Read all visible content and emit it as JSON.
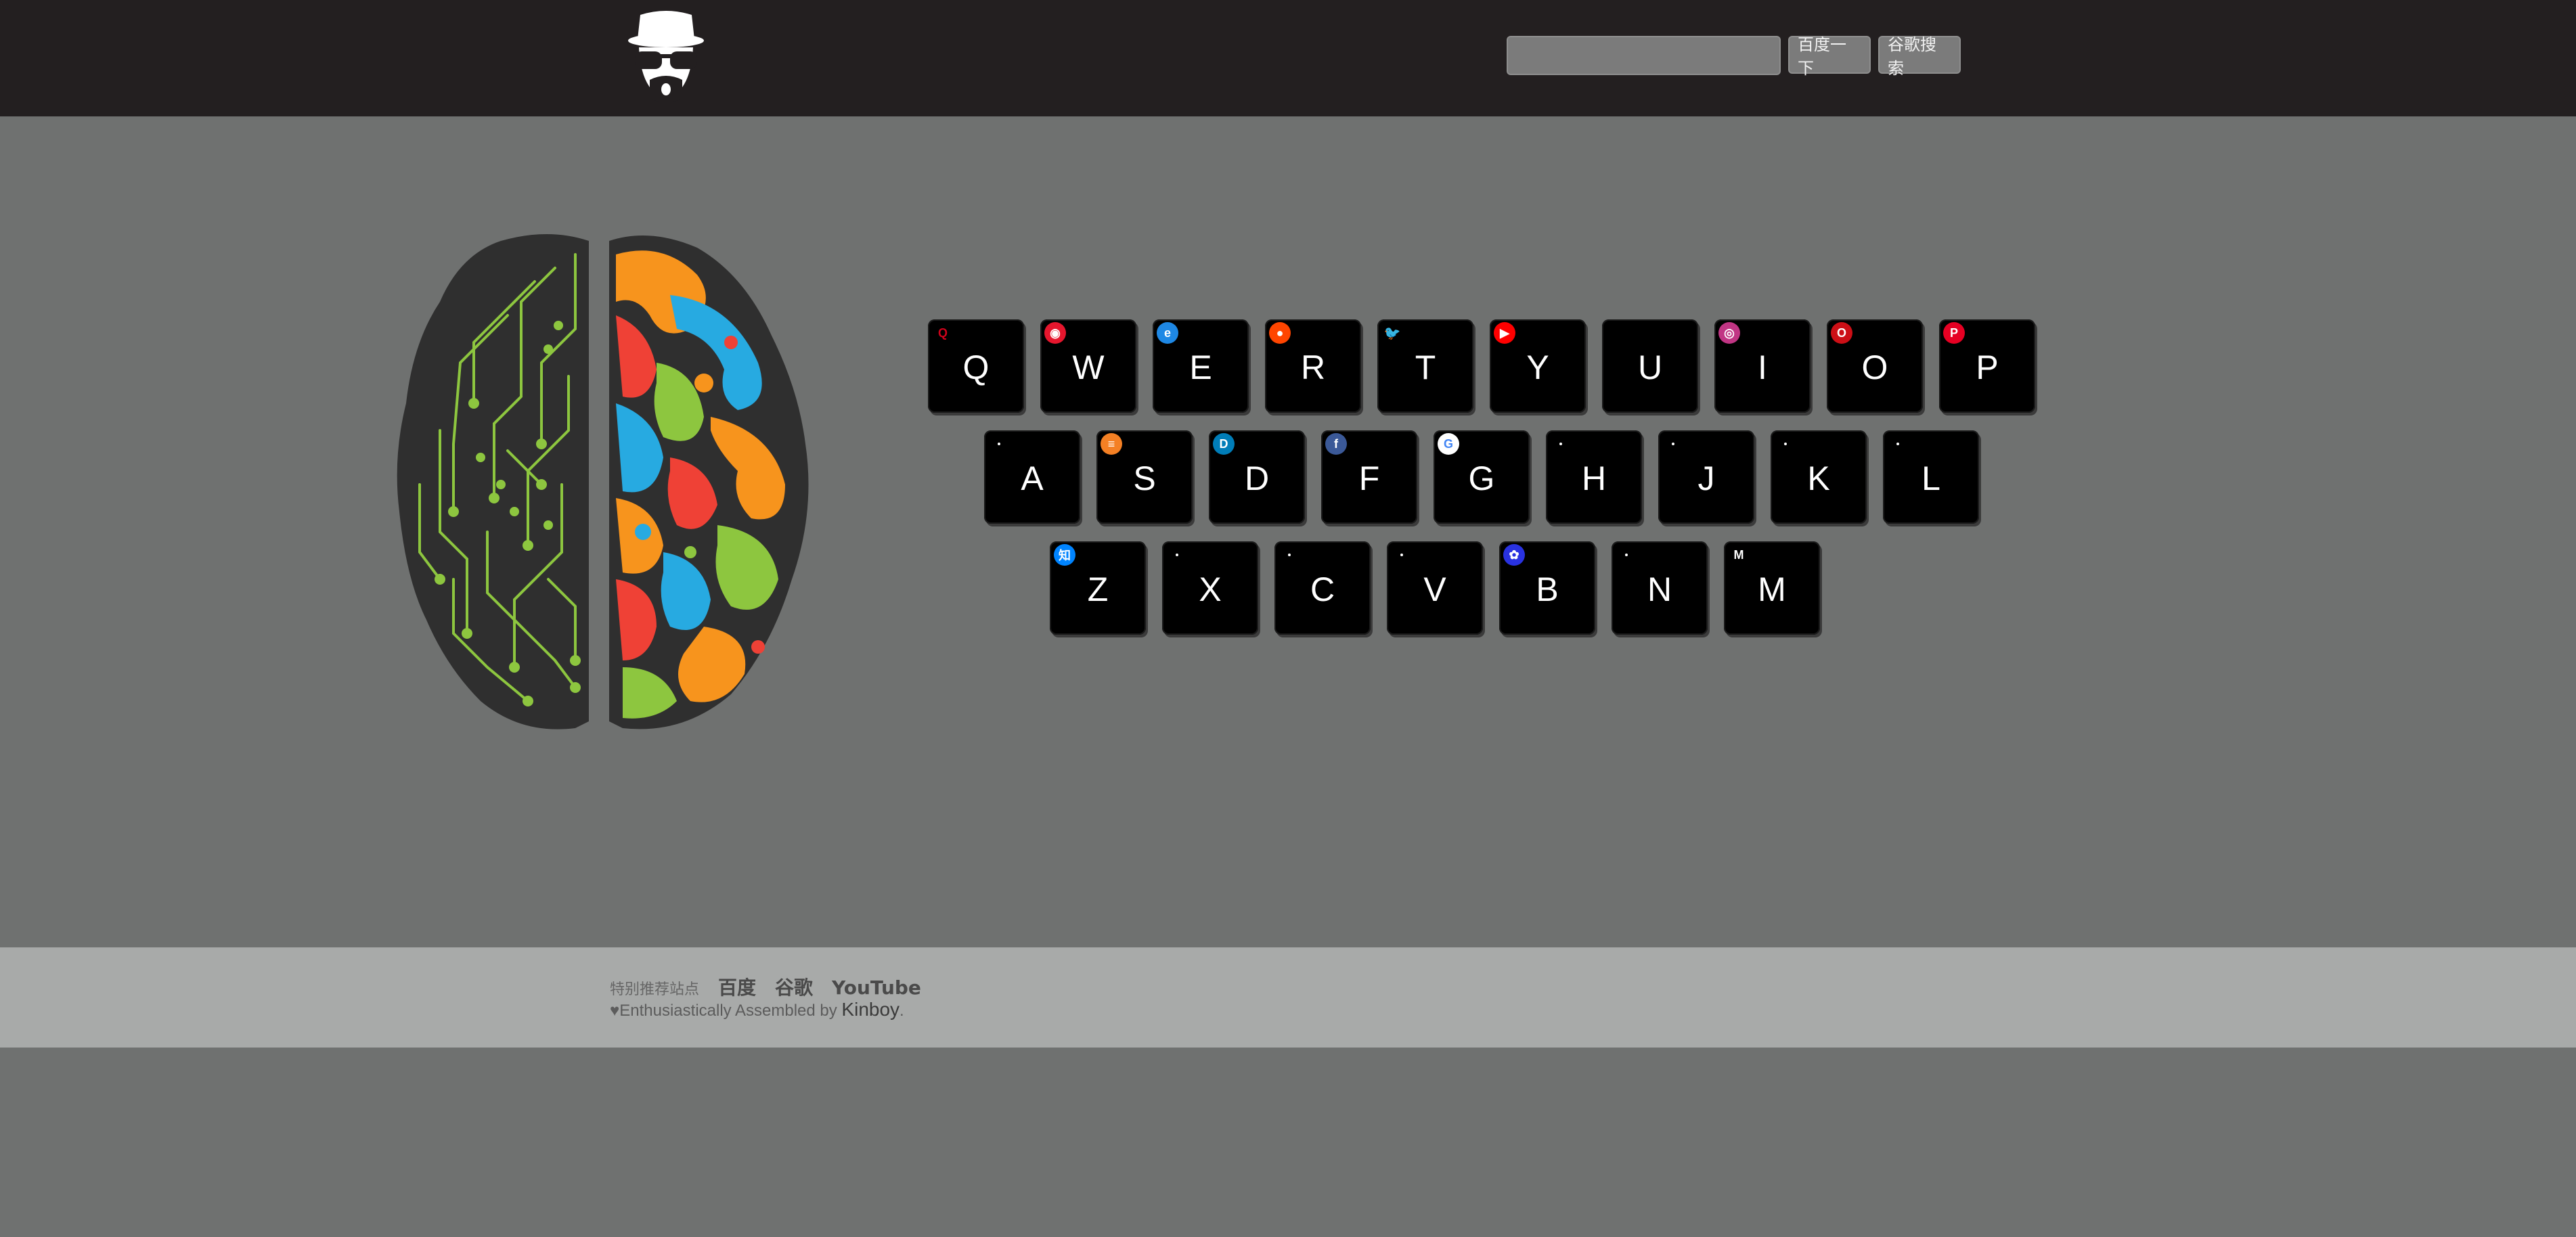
{
  "header": {
    "search_placeholder": "",
    "baidu_button": "百度一下",
    "google_button": "谷歌搜索"
  },
  "keyboard": {
    "row1": [
      {
        "letter": "Q",
        "icon": "qq-icon",
        "color": "#d0021b",
        "glyph": "Q"
      },
      {
        "letter": "W",
        "icon": "weibo-icon",
        "color": "#e6162d",
        "glyph": "◉"
      },
      {
        "letter": "E",
        "icon": "e-icon",
        "color": "#1e88e5",
        "glyph": "e"
      },
      {
        "letter": "R",
        "icon": "reddit-icon",
        "color": "#ff4500",
        "glyph": "●"
      },
      {
        "letter": "T",
        "icon": "twitter-icon",
        "color": "#000000",
        "glyph": "🐦"
      },
      {
        "letter": "Y",
        "icon": "youtube-icon",
        "color": "#ff0000",
        "glyph": "▶"
      },
      {
        "letter": "U",
        "icon": "blank-icon",
        "color": "#000000",
        "glyph": ""
      },
      {
        "letter": "I",
        "icon": "instagram-icon",
        "color": "#c13584",
        "glyph": "◎"
      },
      {
        "letter": "O",
        "icon": "opera-icon",
        "color": "#cc0f16",
        "glyph": "O"
      },
      {
        "letter": "P",
        "icon": "pinterest-icon",
        "color": "#e60023",
        "glyph": "P"
      }
    ],
    "row2": [
      {
        "letter": "A",
        "icon": "dot-icon",
        "color": "",
        "glyph": ""
      },
      {
        "letter": "S",
        "icon": "stackoverflow-icon",
        "color": "#f48024",
        "glyph": "≡"
      },
      {
        "letter": "D",
        "icon": "dell-icon",
        "color": "#007db8",
        "glyph": "D"
      },
      {
        "letter": "F",
        "icon": "facebook-icon",
        "color": "#3b5998",
        "glyph": "f"
      },
      {
        "letter": "G",
        "icon": "google-icon",
        "color": "#ffffff",
        "glyph": "G"
      },
      {
        "letter": "H",
        "icon": "dot-icon",
        "color": "",
        "glyph": ""
      },
      {
        "letter": "J",
        "icon": "dot-icon",
        "color": "",
        "glyph": ""
      },
      {
        "letter": "K",
        "icon": "dot-icon",
        "color": "",
        "glyph": ""
      },
      {
        "letter": "L",
        "icon": "dot-icon",
        "color": "",
        "glyph": ""
      }
    ],
    "row3": [
      {
        "letter": "Z",
        "icon": "zhihu-icon",
        "color": "#0084ff",
        "glyph": "知"
      },
      {
        "letter": "X",
        "icon": "dot-icon",
        "color": "",
        "glyph": ""
      },
      {
        "letter": "C",
        "icon": "dot-icon",
        "color": "",
        "glyph": ""
      },
      {
        "letter": "V",
        "icon": "dot-icon",
        "color": "",
        "glyph": ""
      },
      {
        "letter": "B",
        "icon": "baidu-icon",
        "color": "#2932e1",
        "glyph": "✿"
      },
      {
        "letter": "N",
        "icon": "dot-icon",
        "color": "",
        "glyph": ""
      },
      {
        "letter": "M",
        "icon": "medium-icon",
        "color": "#000000",
        "glyph": "M"
      }
    ]
  },
  "footer": {
    "label": "特别推荐站点",
    "links": [
      "百度",
      "谷歌",
      "YouTube"
    ],
    "credit_prefix": "♥Enthusiastically Assembled by ",
    "credit_author": "Kinboy",
    "credit_suffix": "."
  }
}
